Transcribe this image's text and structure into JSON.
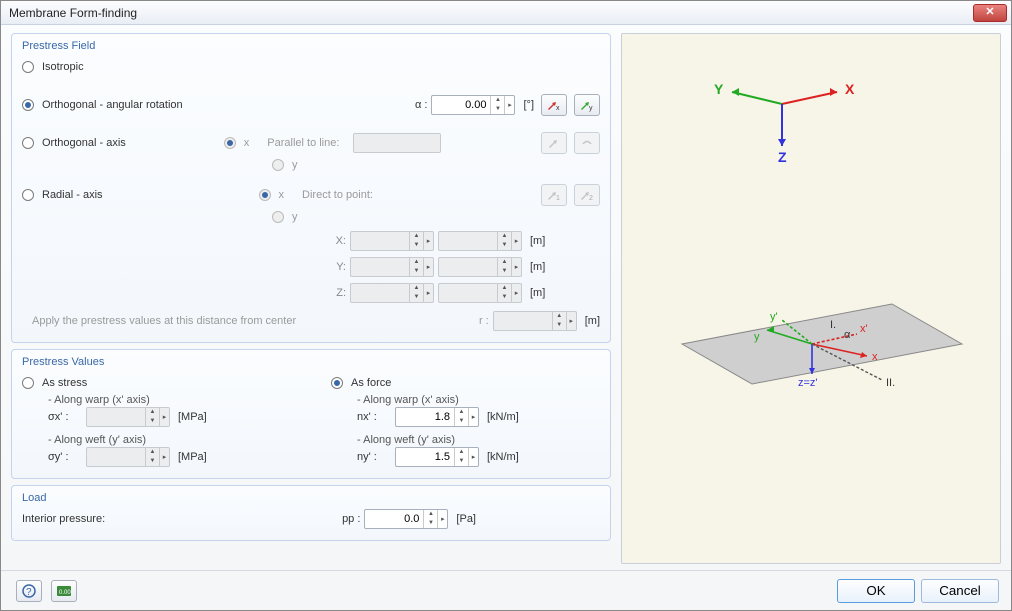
{
  "window": {
    "title": "Membrane Form-finding"
  },
  "prestress_field": {
    "title": "Prestress Field",
    "isotropic": "Isotropic",
    "ortho_angular": "Orthogonal - angular rotation",
    "alpha_label": "α :",
    "alpha_value": "0.00",
    "alpha_unit": "[°]",
    "ortho_axis": "Orthogonal - axis",
    "parallel_label": "Parallel to line:",
    "radial_axis": "Radial - axis",
    "direct_label": "Direct to point:",
    "x": "x",
    "y": "y",
    "X": "X:",
    "Y": "Y:",
    "Z": "Z:",
    "m_unit": "[m]",
    "r_label": "r :",
    "apply_note": "Apply the prestress values at this distance from center"
  },
  "prestress_values": {
    "title": "Prestress Values",
    "as_stress": "As stress",
    "as_force": "As force",
    "along_warp": "- Along warp (x' axis)",
    "along_weft": "- Along weft (y' axis)",
    "sigma_x": "σx' :",
    "sigma_y": "σy' :",
    "n_x": "nx' :",
    "n_y": "ny' :",
    "mpa": "[MPa]",
    "knm": "[kN/m]",
    "nx_val": "1.8",
    "ny_val": "1.5"
  },
  "load": {
    "title": "Load",
    "label": "Interior pressure:",
    "symbol": "pp :",
    "value": "0.0",
    "unit": "[Pa]"
  },
  "buttons": {
    "ok": "OK",
    "cancel": "Cancel"
  },
  "preview": {
    "axis_x": "X",
    "axis_y": "Y",
    "axis_z": "Z",
    "axis_xp": "x",
    "axis_yp": "y",
    "axis_xpp": "x'",
    "axis_ypp": "y'",
    "zeq": "z=z'",
    "alpha": "α",
    "one": "I.",
    "two": "II."
  }
}
